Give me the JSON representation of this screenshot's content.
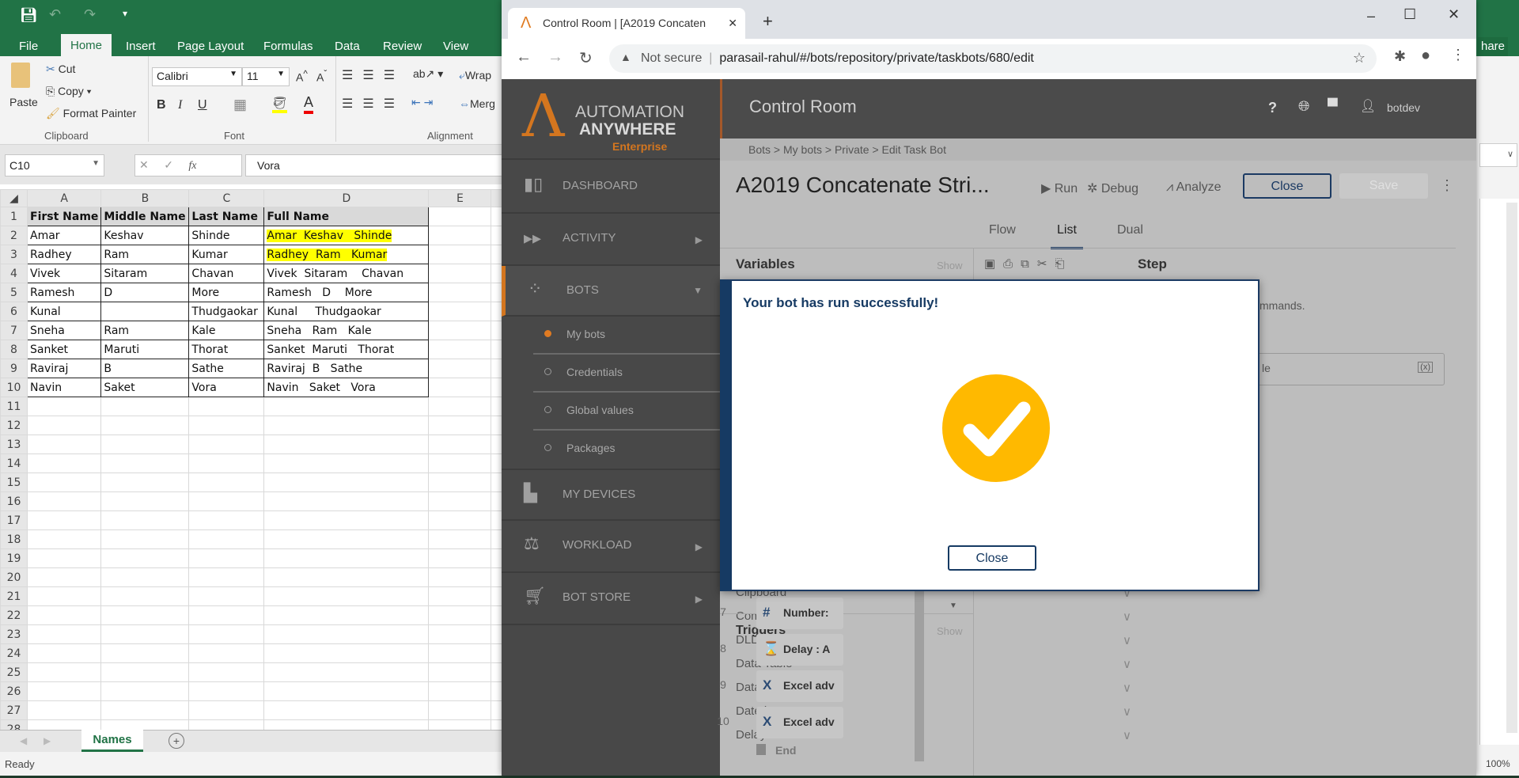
{
  "excel": {
    "tabs": [
      "File",
      "Home",
      "Insert",
      "Page Layout",
      "Formulas",
      "Data",
      "Review",
      "View"
    ],
    "active_tab": "Home",
    "share_label": "hare",
    "clipboard": {
      "paste": "Paste",
      "cut": "Cut",
      "copy": "Copy",
      "format_painter": "Format Painter",
      "group": "Clipboard"
    },
    "font": {
      "name": "Calibri",
      "size": "11",
      "group": "Font",
      "bold": "B",
      "italic": "I",
      "underline": "U"
    },
    "alignment": {
      "wrap": "Wrap",
      "merge": "Merg",
      "group": "Alignment"
    },
    "name_box": "C10",
    "formula": "Vora",
    "fx": "fx",
    "columns": [
      "A",
      "B",
      "C",
      "D",
      "E"
    ],
    "rows": [
      [
        "First Name",
        "Middle Name",
        "Last Name",
        "Full Name"
      ],
      [
        "Amar",
        "Keshav",
        "Shinde",
        "Amar  Keshav   Shinde"
      ],
      [
        "Radhey",
        "Ram",
        "Kumar",
        "Radhey  Ram   Kumar"
      ],
      [
        "Vivek",
        "Sitaram",
        "Chavan",
        "Vivek  Sitaram    Chavan"
      ],
      [
        "Ramesh",
        "D",
        "More",
        "Ramesh   D    More"
      ],
      [
        "Kunal",
        "",
        "Thudgaokar",
        "Kunal     Thudgaokar"
      ],
      [
        "Sneha",
        "Ram",
        "Kale",
        "Sneha   Ram   Kale"
      ],
      [
        "Sanket",
        "Maruti",
        "Thorat",
        "Sanket  Maruti   Thorat"
      ],
      [
        "Raviraj",
        "B",
        "Sathe",
        "Raviraj  B   Sathe"
      ],
      [
        "Navin",
        "Saket",
        "Vora",
        "Navin   Saket   Vora"
      ]
    ],
    "row_count": 28,
    "sheet_tab": "Names",
    "status": "Ready",
    "zoom": "100%"
  },
  "browser": {
    "tab_title": "Control Room | [A2019 Concaten",
    "security": "Not secure",
    "url": "parasail-rahul/#/bots/repository/private/taskbots/680/edit"
  },
  "aa": {
    "logo": {
      "line1": "AUTOMATION",
      "line2": "ANYWHERE",
      "line3": "Enterprise"
    },
    "header_title": "Control Room",
    "user": "botdev",
    "nav": [
      "DASHBOARD",
      "ACTIVITY",
      "BOTS",
      "MY DEVICES",
      "WORKLOAD",
      "BOT STORE"
    ],
    "bots_sub": [
      "My bots",
      "Credentials",
      "Global values",
      "Packages"
    ],
    "breadcrumb": [
      "Bots",
      ">",
      "My bots",
      ">",
      "Private",
      ">",
      "Edit Task Bot"
    ],
    "bot_title": "A2019 Concatenate Stri...",
    "actions": {
      "run": "Run",
      "debug": "Debug",
      "analyze": "Analyze",
      "close": "Close",
      "save": "Save"
    },
    "view_tabs": [
      "Flow",
      "List",
      "Dual"
    ],
    "active_view": "List",
    "variables_label": "Variables",
    "show": "Show",
    "step_label": "Step",
    "commands_hint": "mmands.",
    "search_partial": "le",
    "actions_list": [
      "Clipboard",
      "Comment",
      "DLL",
      "Data Table",
      "Database",
      "Datetime",
      "Delay"
    ],
    "triggers": "Triggers",
    "steps": [
      {
        "n": "7",
        "label": "Number:"
      },
      {
        "n": "8",
        "label": "Delay : A"
      },
      {
        "n": "9",
        "label": "Excel adv"
      },
      {
        "n": "10",
        "label": "Excel adv"
      }
    ],
    "end": "End",
    "modal": {
      "message": "Your bot has run successfully!",
      "close": "Close"
    }
  },
  "colors": {
    "excel_green": "#217346",
    "aa_dark": "#484848",
    "accent_orange": "#e07b22",
    "modal_blue": "#163a63",
    "check_yellow": "#ffb900",
    "highlight": "#ffff00"
  }
}
